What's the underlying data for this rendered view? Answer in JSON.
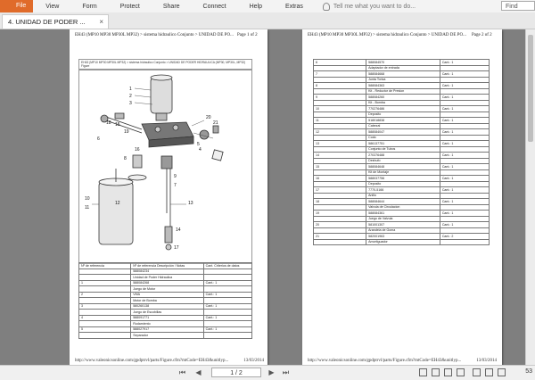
{
  "menu": {
    "items": [
      "File",
      "View",
      "Form",
      "Protect",
      "Share",
      "Connect",
      "Help",
      "Extras"
    ],
    "tell_me": "Tell me what you want to do...",
    "find_placeholder": "Find"
  },
  "tab": {
    "title": "4. UNIDAD DE PODER ...",
    "close": "×"
  },
  "page1": {
    "header": "EH43 (MP10 MP30 MP30L MP32) > sistema hidraulico Conjunto > UNIDAD DE PO...",
    "page_label": "Page 1 of 2",
    "box_title": "EH43 (MP10 MP30 MP30L MP32) > sistema hidraulico Conjunto > UNIDAD DE PODER HIDRAULICA (MP30, MP30L, MP32) Figure",
    "footer_url": "http://www.valeonicsonline.com/gpdptrvl/parts/Figure.cfm?mtCode=EH43&unitlyp...",
    "footer_date": "13/03/2014",
    "table_headers": [
      "Nº de referencia",
      "Nº de referencia Descripción / Notas",
      "Cant. Criterios de datos"
    ],
    "rows": [
      [
        "",
        "588084234",
        ""
      ],
      [
        "",
        "Unidad de Poder Hidraulica",
        ""
      ],
      [
        "1",
        "588084268",
        "Cant.: 1"
      ],
      [
        "",
        "Juego de Motor",
        ""
      ],
      [
        "2",
        "VMA",
        "Cant.: 1"
      ],
      [
        "",
        "Motor de Bomba",
        ""
      ],
      [
        "3",
        "580260138",
        "Cant.: 1"
      ],
      [
        "",
        "Juego de Escobillas",
        ""
      ],
      [
        "4",
        "588091771",
        "Cant.: 1"
      ],
      [
        "",
        "Rodamiento",
        ""
      ],
      [
        "5",
        "588027917",
        "Cant.: 1"
      ],
      [
        "",
        "Separador",
        ""
      ]
    ],
    "callouts": [
      "1",
      "2",
      "3",
      "4",
      "5",
      "6",
      "7",
      "8",
      "9",
      "10",
      "11",
      "12",
      "13",
      "14",
      "15",
      "16",
      "17",
      "18",
      "19",
      "20",
      "21"
    ]
  },
  "page2": {
    "header": "EH43 (MP10 MP30 MP30L MP32) > sistema hidraulico Conjunto > UNIDAD DE PO...",
    "page_label": "Page 2 of 2",
    "footer_url": "http://www.valeonicsonline.com/gpdptrvl/parts/Figure.cfm?mtCode=EH43&unitlyp...",
    "footer_date": "13/03/2014",
    "rows": [
      [
        "6",
        "588084570",
        "Cant.: 1"
      ],
      [
        "",
        "Adaptador de entrada",
        ""
      ],
      [
        "7",
        "588084668",
        "Cant.: 1"
      ],
      [
        "",
        "Junta Torica",
        ""
      ],
      [
        "8",
        "588084363",
        "Cant.: 1"
      ],
      [
        "",
        "Kit - Reductor de Presion",
        ""
      ],
      [
        "9",
        "588084260",
        "Cant.: 1"
      ],
      [
        "",
        "Kit - Bomba",
        ""
      ],
      [
        "10",
        "770276486",
        "Cant.: 1"
      ],
      [
        "",
        "Deposito",
        ""
      ],
      [
        "11",
        "518018838",
        "Cant.: 1"
      ],
      [
        "",
        "Cabezal",
        ""
      ],
      [
        "12",
        "588084047",
        "Cant.: 1"
      ],
      [
        "",
        "Codo",
        ""
      ],
      [
        "13",
        "586137751",
        "Cant.: 1"
      ],
      [
        "",
        "Conjunto de Tubos",
        ""
      ],
      [
        "14",
        "270376488",
        "Cant.: 1"
      ],
      [
        "",
        "Deshufo",
        ""
      ],
      [
        "15",
        "588084648",
        "Cant.: 1"
      ],
      [
        "",
        "Kit de Montaje",
        ""
      ],
      [
        "16",
        "588037756",
        "Cant.: 1"
      ],
      [
        "",
        "Deposito",
        ""
      ],
      [
        "17",
        "7770-5166",
        "Cant.: 1"
      ],
      [
        "",
        "Anillo",
        ""
      ],
      [
        "18",
        "588084644",
        "Cant.: 1"
      ],
      [
        "",
        "Valvula de Circulacion",
        ""
      ],
      [
        "19",
        "588084361",
        "Cant.: 1"
      ],
      [
        "",
        "Juego de Valvula",
        ""
      ],
      [
        "20",
        "581001307",
        "Cant.: 1"
      ],
      [
        "",
        "Arandela de Goma",
        ""
      ],
      [
        "21",
        "582001963",
        "Cant.: 2"
      ],
      [
        "",
        "Amortiguador",
        ""
      ]
    ]
  },
  "bottom": {
    "page_indicator": "1 / 2",
    "zoom": "53"
  }
}
